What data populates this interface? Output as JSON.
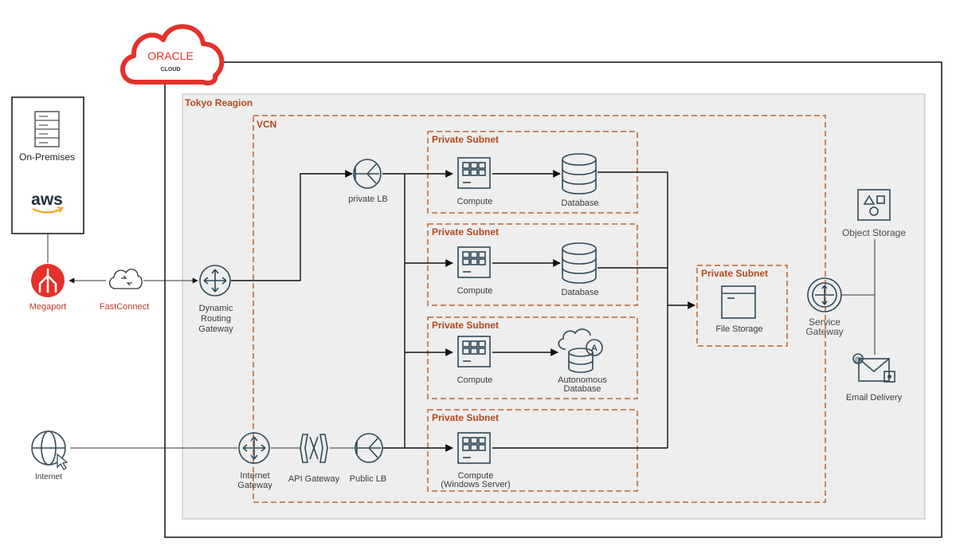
{
  "brand": {
    "logo_name": "ORACLE",
    "logo_sub": "CLOUD",
    "accent": "#e4312b"
  },
  "colors": {
    "subnet_border": "#c0632b",
    "subnet_title": "#b5491b",
    "icon": "#2f4a58",
    "region_fill": "#eeeeee"
  },
  "region": {
    "title": "Tokyo Reagion"
  },
  "vcn": {
    "title": "VCN"
  },
  "onprem": {
    "label": "On-Premises",
    "aws_label": "aws"
  },
  "external": {
    "megaport": "Megaport",
    "fastconnect": "FastConnect",
    "internet": "Internet"
  },
  "gateways": {
    "drg_line1": "Dynamic",
    "drg_line2": "Routing",
    "drg_line3": "Gateway",
    "igw_line1": "Internet",
    "igw_line2": "Gateway",
    "api_gw": "API Gateway",
    "private_lb": "private LB",
    "public_lb": "Public LB",
    "sgw_line1": "Service",
    "sgw_line2": "Gateway"
  },
  "subnets": [
    {
      "title": "Private Subnet",
      "compute": "Compute",
      "db": "Database"
    },
    {
      "title": "Private Subnet",
      "compute": "Compute",
      "db": "Database"
    },
    {
      "title": "Private Subnet",
      "compute": "Compute",
      "db_line1": "Autonomous",
      "db_line2": "Database"
    },
    {
      "title": "Private Subnet",
      "compute": "Compute",
      "compute_line2": "(Windows Server)"
    }
  ],
  "storage_subnet": {
    "title": "Private Subnet",
    "label": "File Storage"
  },
  "services": {
    "object_storage": "Object Storage",
    "email_delivery": "Email Delivery"
  }
}
